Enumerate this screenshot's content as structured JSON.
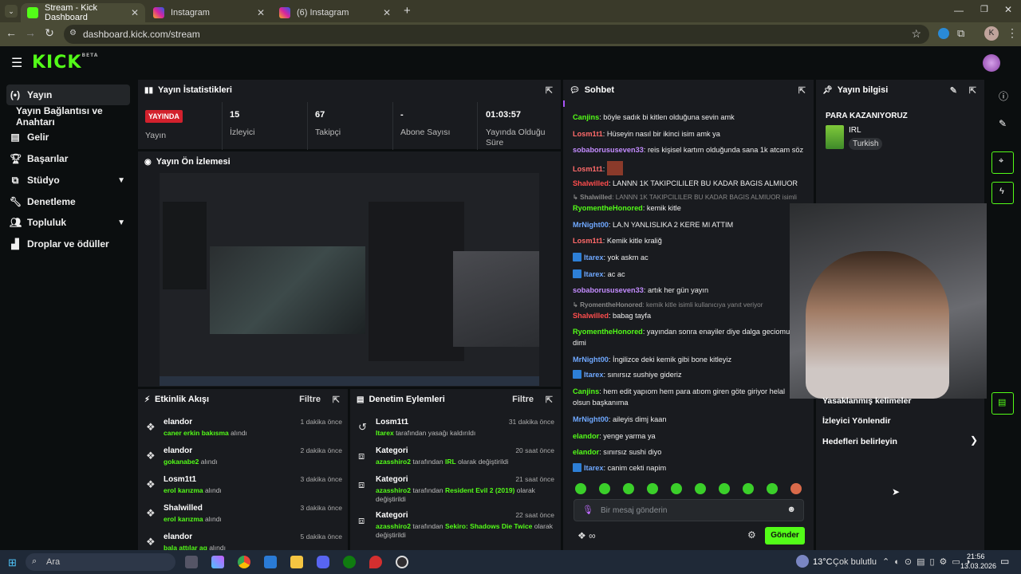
{
  "browser": {
    "tabs": [
      {
        "label": "Stream - Kick Dashboard"
      },
      {
        "label": "Instagram"
      },
      {
        "label": "(6) Instagram"
      }
    ],
    "url": "dashboard.kick.com/stream",
    "profile_initial": "K"
  },
  "kick": {
    "logo": "KICK",
    "beta": "BETA"
  },
  "sidebar": {
    "items": [
      {
        "label": "Yayın",
        "icon": "broadcast-icon"
      },
      {
        "label": "Yayın Bağlantısı ve Anahtarı",
        "icon": ""
      },
      {
        "label": "Gelir",
        "icon": "revenue-icon"
      },
      {
        "label": "Başarılar",
        "icon": "trophy-icon"
      },
      {
        "label": "Stüdyo",
        "icon": "studio-icon"
      },
      {
        "label": "Denetleme",
        "icon": "wrench-icon"
      },
      {
        "label": "Topluluk",
        "icon": "community-icon"
      },
      {
        "label": "Droplar ve ödüller",
        "icon": "drops-icon"
      }
    ]
  },
  "stats": {
    "title": "Yayın İstatistikleri",
    "live_badge": "YAYINDA",
    "live_label": "Yayın",
    "viewers": "15",
    "viewers_label": "İzleyici",
    "followers": "67",
    "followers_label": "Takipçi",
    "subs": "-",
    "subs_label": "Abone Sayısı",
    "uptime": "01:03:57",
    "uptime_label": "Yayında Olduğu Süre"
  },
  "preview": {
    "title": "Yayın Ön İzlemesi"
  },
  "activity": {
    "title": "Etkinlik Akışı",
    "filter": "Filtre",
    "items": [
      {
        "name": "elandor",
        "who": "caner erkin bakısma",
        "action": "alındı",
        "time": "1 dakika önce"
      },
      {
        "name": "elandor",
        "who": "gokanabe2",
        "action": "alındı",
        "time": "2 dakika önce"
      },
      {
        "name": "Losm1t1",
        "who": "erol karızma",
        "action": "alındı",
        "time": "3 dakika önce"
      },
      {
        "name": "Shalwilled",
        "who": "erol karızma",
        "action": "alındı",
        "time": "3 dakika önce"
      },
      {
        "name": "elandor",
        "who": "bala attılar ag",
        "action": "alındı",
        "time": "5 dakika önce"
      }
    ]
  },
  "moderation": {
    "title": "Denetim Eylemleri",
    "filter": "Filtre",
    "items": [
      {
        "name": "Losm1t1",
        "desc_user": "Itarex",
        "desc": "tarafından yasağı kaldırıldı",
        "desc_extra": "",
        "desc_tail": "",
        "time": "31 dakika önce"
      },
      {
        "name": "Kategori",
        "desc_user": "azasshiro2",
        "desc": "tarafından",
        "desc_extra": "IRL",
        "desc_tail": "olarak değiştirildi",
        "time": "20 saat önce"
      },
      {
        "name": "Kategori",
        "desc_user": "azasshiro2",
        "desc": "tarafından",
        "desc_extra": "Resident Evil 2 (2019)",
        "desc_tail": "olarak değiştirildi",
        "time": "21 saat önce"
      },
      {
        "name": "Kategori",
        "desc_user": "azasshiro2",
        "desc": "tarafından",
        "desc_extra": "Sekiro: Shadows Die Twice",
        "desc_tail": "olarak değiştirildi",
        "time": "22 saat önce"
      }
    ]
  },
  "chat": {
    "title": "Sohbet",
    "messages": [
      {
        "user": "Canjins",
        "color": "#53fc18",
        "text": "böyle sadık bi kitlen olduğuna sevin amk"
      },
      {
        "user": "Losm1t1",
        "color": "#ff6a6a",
        "text": "Hüseyin nasıl bir ikinci isim amk ya"
      },
      {
        "user": "sobaborususeven33",
        "color": "#c38cff",
        "text": "reis kişisel kartım olduğunda sana 1k atcam söz"
      },
      {
        "user": "Losm1t1",
        "color": "#ff6a6a",
        "text": ""
      },
      {
        "user": "Shalwilled",
        "color": "#ff4d4d",
        "text": "LANNN 1K TAKIPCILILER BU KADAR BAGIS ALMIUOR"
      },
      {
        "user": "↳ Shalwilled",
        "color": "#888",
        "text": "LANNN 1K TAKIPCILILER BU KADAR BAGIS ALMIUOR isimli ..."
      },
      {
        "user": "RyomentheHonored",
        "color": "#53fc18",
        "text": "kemik kitle"
      },
      {
        "user": "MrNight00",
        "color": "#6fa8ff",
        "text": "LA.N YANLISLIKA 2 KERE MI ATTIM"
      },
      {
        "user": "Losm1t1",
        "color": "#ff6a6a",
        "text": "Kemik kitle kraliğ"
      },
      {
        "user": "Itarex",
        "color": "#6fa8ff",
        "text": "yok askm ac"
      },
      {
        "user": "Itarex",
        "color": "#6fa8ff",
        "text": "ac ac"
      },
      {
        "user": "sobaborususeven33",
        "color": "#c38cff",
        "text": "artık her gün yayın"
      },
      {
        "user": "↳ RyomentheHonored",
        "color": "#888",
        "text": "kemik kitle isimli kullanıcıya yanıt veriyor"
      },
      {
        "user": "Shalwilled",
        "color": "#ff4d4d",
        "text": "babag tayfa"
      },
      {
        "user": "RyomentheHonored",
        "color": "#53fc18",
        "text": "yayından sonra enayiler diye dalga geciomus dimi"
      },
      {
        "user": "MrNight00",
        "color": "#6fa8ff",
        "text": "İngilizce deki kemik gibi bone kitleyiz"
      },
      {
        "user": "Itarex",
        "color": "#6fa8ff",
        "text": "sınırsız sushiye gideriz"
      },
      {
        "user": "Canjins",
        "color": "#53fc18",
        "text": "hem edit yapıom hem para atıom giren göte giriyor helal olsun başkanıma"
      },
      {
        "user": "MrNight00",
        "color": "#6fa8ff",
        "text": "aileyis dimj kaan"
      },
      {
        "user": "elandor",
        "color": "#53fc18",
        "text": "yenge yarma ya"
      },
      {
        "user": "elandor",
        "color": "#53fc18",
        "text": "sınırsız sushi diyo"
      },
      {
        "user": "Itarex",
        "color": "#6fa8ff",
        "text": "canim cekti napim"
      }
    ],
    "placeholder": "Bir mesaj gönderin",
    "send": "Gönder"
  },
  "info": {
    "title": "Yayın bilgisi",
    "stream_title": "PARA KAZANIYORUZ",
    "category": "IRL",
    "language": "Turkish",
    "actions": [
      "Yasaklanmış kelimeler",
      "İzleyici Yönlendir",
      "Hedefleri belirleyin"
    ]
  },
  "taskbar": {
    "search": "Ara",
    "weather": "13°C",
    "weather_desc": "Çok bulutlu",
    "time": "21:56",
    "date": "13.03.2026"
  },
  "colors": {
    "accent": "#53fc18",
    "live": "#d3212d",
    "panel": "#191b1f",
    "bg": "#0b0e0f"
  }
}
